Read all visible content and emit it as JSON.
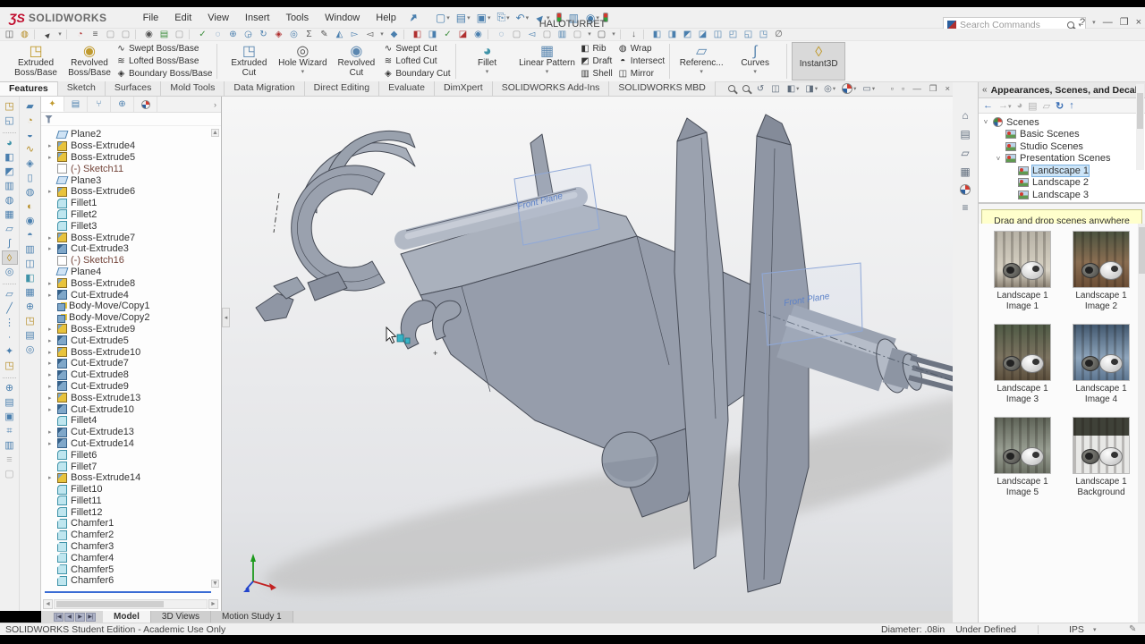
{
  "titlebar": {
    "logo_mark": "ƷS",
    "logo_text": "SOLIDWORKS",
    "menus": [
      "File",
      "Edit",
      "View",
      "Insert",
      "Tools",
      "Window",
      "Help"
    ],
    "title": "HALOTURRET",
    "search_placeholder": "Search Commands",
    "help_btn": "?",
    "win_min": "—",
    "win_restore": "❐",
    "win_close": "×"
  },
  "qat": [
    {
      "g": "▢",
      "car": "▾"
    },
    {
      "g": "▤",
      "car": "▾"
    },
    {
      "g": "▣",
      "car": "▾"
    },
    {
      "g": "⎘",
      "car": "▾"
    },
    {
      "g": "↶",
      "car": "▾"
    },
    {
      "g": "►",
      "cls": "curs",
      "car": "▾"
    },
    {
      "g": "",
      "cls": "tl"
    },
    {
      "g": "▥"
    },
    {
      "g": "◉",
      "car": "▾"
    }
  ],
  "toolbar2": [
    {
      "g": "◫",
      "cls": "dk"
    },
    {
      "g": "◍",
      "cls": "gold"
    },
    {
      "g": "",
      "cls": "sep"
    },
    {
      "g": "►",
      "cls": "curs"
    },
    {
      "g": "▾",
      "cls": "car"
    },
    {
      "g": "",
      "cls": "sep"
    },
    {
      "g": "◔",
      "cls": "red"
    },
    {
      "g": "≡",
      "cls": "dk"
    },
    {
      "g": "▢",
      "cls": "gray"
    },
    {
      "g": "▢",
      "cls": "gray"
    },
    {
      "g": "",
      "cls": "sep"
    },
    {
      "g": "◉",
      "cls": "dk"
    },
    {
      "g": "▤",
      "cls": "grn"
    },
    {
      "g": "▢",
      "cls": "gray"
    },
    {
      "g": "",
      "cls": "sep"
    },
    {
      "g": "✓",
      "cls": "grn"
    },
    {
      "g": "◌",
      "cls": ""
    },
    {
      "g": "⊕",
      "cls": ""
    },
    {
      "g": "◶",
      "cls": ""
    },
    {
      "g": "↻",
      "cls": ""
    },
    {
      "g": "◈",
      "cls": "red"
    },
    {
      "g": "◎",
      "cls": ""
    },
    {
      "g": "Σ",
      "cls": "dk"
    },
    {
      "g": "✎",
      "cls": "dk"
    },
    {
      "g": "◭",
      "cls": ""
    },
    {
      "g": "▻",
      "cls": ""
    },
    {
      "g": "◅",
      "cls": "dk"
    },
    {
      "g": "▾",
      "cls": "car"
    },
    {
      "g": "◆",
      "cls": ""
    },
    {
      "g": "",
      "cls": "sep"
    },
    {
      "g": "◧",
      "cls": "red"
    },
    {
      "g": "◨",
      "cls": ""
    },
    {
      "g": "✓",
      "cls": "grn"
    },
    {
      "g": "◪",
      "cls": "red"
    },
    {
      "g": "◉",
      "cls": ""
    },
    {
      "g": "",
      "cls": "sep"
    },
    {
      "g": "◌",
      "cls": ""
    },
    {
      "g": "▢",
      "cls": "gray"
    },
    {
      "g": "◅",
      "cls": ""
    },
    {
      "g": "▢",
      "cls": "gray"
    },
    {
      "g": "▥",
      "cls": ""
    },
    {
      "g": "▢",
      "cls": "gray"
    },
    {
      "g": "▾",
      "cls": "car"
    },
    {
      "g": "▢",
      "cls": "dk"
    },
    {
      "g": "▾",
      "cls": "car"
    },
    {
      "g": "",
      "cls": "sep"
    },
    {
      "g": "↓",
      "cls": "dk"
    },
    {
      "g": "",
      "cls": "sep"
    },
    {
      "g": "◧",
      "cls": ""
    },
    {
      "g": "◨",
      "cls": ""
    },
    {
      "g": "◩",
      "cls": ""
    },
    {
      "g": "◪",
      "cls": ""
    },
    {
      "g": "◫",
      "cls": ""
    },
    {
      "g": "◰",
      "cls": ""
    },
    {
      "g": "◱",
      "cls": ""
    },
    {
      "g": "◳",
      "cls": ""
    },
    {
      "g": "∅",
      "cls": "dk"
    }
  ],
  "ribbon": {
    "b_extruded_boss": {
      "l1": "Extruded",
      "l2": "Boss/Base",
      "g": "◳"
    },
    "b_revolved_boss": {
      "l1": "Revolved",
      "l2": "Boss/Base",
      "g": "◉"
    },
    "stack1": [
      {
        "t": "Swept Boss/Base",
        "g": "∿",
        "cls": "gold"
      },
      {
        "t": "Lofted Boss/Base",
        "g": "≋",
        "cls": "gold"
      },
      {
        "t": "Boundary Boss/Base",
        "g": "◈",
        "cls": "gold"
      }
    ],
    "b_extruded_cut": {
      "l1": "Extruded",
      "l2": "Cut",
      "g": "◳"
    },
    "b_hole_wizard": {
      "l1": "Hole Wizard",
      "g": "◎"
    },
    "b_revolved_cut": {
      "l1": "Revolved",
      "l2": "Cut",
      "g": "◉"
    },
    "stack2": [
      {
        "t": "Swept Cut",
        "g": "∿",
        "cls": "blue"
      },
      {
        "t": "Lofted Cut",
        "g": "≋",
        "cls": "blue"
      },
      {
        "t": "Boundary Cut",
        "g": "◈",
        "cls": "blue"
      }
    ],
    "b_fillet": {
      "l1": "Fillet",
      "g": "◕"
    },
    "b_linear_pattern": {
      "l1": "Linear Pattern",
      "g": "▦"
    },
    "stack3a": [
      {
        "t": "Rib",
        "g": "◧",
        "cls": "blue"
      },
      {
        "t": "Draft",
        "g": "◩",
        "cls": "blue"
      },
      {
        "t": "Shell",
        "g": "▥",
        "cls": "blue"
      }
    ],
    "stack3b": [
      {
        "t": "Wrap",
        "g": "◍",
        "cls": "blue"
      },
      {
        "t": "Intersect",
        "g": "◓",
        "cls": "blue"
      },
      {
        "t": "Mirror",
        "g": "◫",
        "cls": "blue"
      }
    ],
    "b_reference": {
      "l1": "Referenc...",
      "g": "▱"
    },
    "b_curves": {
      "l1": "Curves",
      "g": "∫"
    },
    "b_instant3d": {
      "l1": "Instant3D",
      "g": "◊"
    }
  },
  "tabs": [
    {
      "t": "Features",
      "cls": "active"
    },
    {
      "t": "Sketch"
    },
    {
      "t": "Surfaces"
    },
    {
      "t": "Mold Tools"
    },
    {
      "t": "Data Migration"
    },
    {
      "t": "Direct Editing"
    },
    {
      "t": "Evaluate"
    },
    {
      "t": "DimXpert"
    },
    {
      "t": "SOLIDWORKS Add-Ins"
    },
    {
      "t": "SOLIDWORKS MBD"
    }
  ],
  "headsup": [
    {
      "g": "",
      "cls": "magic"
    },
    {
      "g": "",
      "cls": "magic"
    },
    {
      "g": "↺"
    },
    {
      "g": "◫"
    },
    {
      "g": "◧",
      "car": "▾"
    },
    {
      "g": "◨",
      "car": "▾"
    },
    {
      "g": "◎",
      "car": "▾"
    },
    {
      "g": "",
      "cls": "ballic",
      "car": "▾"
    },
    {
      "g": "▭",
      "car": "▾"
    }
  ],
  "docwin": [
    {
      "g": "▫"
    },
    {
      "g": "▫"
    },
    {
      "g": "—"
    },
    {
      "g": "❒"
    },
    {
      "g": "×"
    }
  ],
  "left_col1": [
    {
      "g": "◳",
      "cls": "gold"
    },
    {
      "g": "◱",
      "cls": "blue"
    },
    {
      "g": "",
      "cls": "sep"
    },
    {
      "g": "◕",
      "cls": "cyan"
    },
    {
      "g": "◧",
      "cls": "blue"
    },
    {
      "g": "◩",
      "cls": "blue"
    },
    {
      "g": "▥",
      "cls": "blue"
    },
    {
      "g": "◍",
      "cls": "blue"
    },
    {
      "g": "▦",
      "cls": "blue"
    },
    {
      "g": "▱",
      "cls": "blue"
    },
    {
      "g": "∫",
      "cls": "blue"
    },
    {
      "g": "◊",
      "cls": "gold act"
    },
    {
      "g": "◎",
      "cls": "blue"
    },
    {
      "g": "",
      "cls": "sep"
    },
    {
      "g": "▱",
      "cls": "blue"
    },
    {
      "g": "╱",
      "cls": "blue"
    },
    {
      "g": "⋮",
      "cls": "blue"
    },
    {
      "g": "∙",
      "cls": "blue"
    },
    {
      "g": "✦",
      "cls": "blue"
    },
    {
      "g": "◳",
      "cls": "gold"
    },
    {
      "g": "",
      "cls": "sep"
    },
    {
      "g": "⊕",
      "cls": "blue"
    },
    {
      "g": "▤",
      "cls": "blue"
    },
    {
      "g": "▣",
      "cls": "blue"
    },
    {
      "g": "⌗",
      "cls": "blue"
    },
    {
      "g": "▥",
      "cls": "blue"
    },
    {
      "g": "≡",
      "cls": "dim"
    },
    {
      "g": "▢",
      "cls": "dim"
    }
  ],
  "left_col2": [
    {
      "g": "▰",
      "cls": "blue"
    },
    {
      "g": "◔",
      "cls": "gold"
    },
    {
      "g": "◒",
      "cls": "blue"
    },
    {
      "g": "∿",
      "cls": "gold"
    },
    {
      "g": "◈",
      "cls": "blue"
    },
    {
      "g": "▯",
      "cls": "blue"
    },
    {
      "g": "◍",
      "cls": "blue"
    },
    {
      "g": "◐",
      "cls": "gold"
    },
    {
      "g": "◉",
      "cls": "blue"
    },
    {
      "g": "◓",
      "cls": "blue"
    },
    {
      "g": "▥",
      "cls": "blue"
    },
    {
      "g": "◫",
      "cls": "blue"
    },
    {
      "g": "◧",
      "cls": "cyan"
    },
    {
      "g": "▦",
      "cls": "blue"
    },
    {
      "g": "⊕",
      "cls": "blue"
    },
    {
      "g": "◳",
      "cls": "gold"
    },
    {
      "g": "▤",
      "cls": "blue"
    },
    {
      "g": "◎",
      "cls": "blue"
    }
  ],
  "tree_tabs": [
    {
      "g": "✦",
      "cls": "active"
    },
    {
      "g": "▤"
    },
    {
      "g": "⑂"
    },
    {
      "g": "⊕"
    },
    {
      "g": ""
    }
  ],
  "tree_more": "›",
  "feature_tree": {
    "items": [
      {
        "t": "Plane2",
        "cls": "ic-plane"
      },
      {
        "t": "Boss-Extrude4",
        "cls": "ic-boss exp"
      },
      {
        "t": "Boss-Extrude5",
        "cls": "ic-boss exp"
      },
      {
        "t": "(-) Sketch11",
        "cls": "ic-sketch"
      },
      {
        "t": "Plane3",
        "cls": "ic-plane"
      },
      {
        "t": "Boss-Extrude6",
        "cls": "ic-boss exp"
      },
      {
        "t": "Fillet1",
        "cls": "ic-fillet"
      },
      {
        "t": "Fillet2",
        "cls": "ic-fillet"
      },
      {
        "t": "Fillet3",
        "cls": "ic-fillet"
      },
      {
        "t": "Boss-Extrude7",
        "cls": "ic-boss exp"
      },
      {
        "t": "Cut-Extrude3",
        "cls": "ic-cut exp"
      },
      {
        "t": "(-) Sketch16",
        "cls": "ic-sketch"
      },
      {
        "t": "Plane4",
        "cls": "ic-plane"
      },
      {
        "t": "Boss-Extrude8",
        "cls": "ic-boss exp"
      },
      {
        "t": "Cut-Extrude4",
        "cls": "ic-cut exp"
      },
      {
        "t": "Body-Move/Copy1",
        "cls": "ic-move"
      },
      {
        "t": "Body-Move/Copy2",
        "cls": "ic-move"
      },
      {
        "t": "Boss-Extrude9",
        "cls": "ic-boss exp"
      },
      {
        "t": "Cut-Extrude5",
        "cls": "ic-cut exp"
      },
      {
        "t": "Boss-Extrude10",
        "cls": "ic-boss exp"
      },
      {
        "t": "Cut-Extrude7",
        "cls": "ic-cut exp"
      },
      {
        "t": "Cut-Extrude8",
        "cls": "ic-cut exp"
      },
      {
        "t": "Cut-Extrude9",
        "cls": "ic-cut exp"
      },
      {
        "t": "Boss-Extrude13",
        "cls": "ic-boss exp"
      },
      {
        "t": "Cut-Extrude10",
        "cls": "ic-cut exp"
      },
      {
        "t": "Fillet4",
        "cls": "ic-fillet"
      },
      {
        "t": "Cut-Extrude13",
        "cls": "ic-cut exp"
      },
      {
        "t": "Cut-Extrude14",
        "cls": "ic-cut exp"
      },
      {
        "t": "Fillet6",
        "cls": "ic-fillet"
      },
      {
        "t": "Fillet7",
        "cls": "ic-fillet"
      },
      {
        "t": "Boss-Extrude14",
        "cls": "ic-boss exp"
      },
      {
        "t": "Fillet10",
        "cls": "ic-fillet"
      },
      {
        "t": "Fillet11",
        "cls": "ic-fillet"
      },
      {
        "t": "Fillet12",
        "cls": "ic-fillet"
      },
      {
        "t": "Chamfer1",
        "cls": "ic-cham"
      },
      {
        "t": "Chamfer2",
        "cls": "ic-cham"
      },
      {
        "t": "Chamfer3",
        "cls": "ic-cham"
      },
      {
        "t": "Chamfer4",
        "cls": "ic-cham"
      },
      {
        "t": "Chamfer5",
        "cls": "ic-cham"
      },
      {
        "t": "Chamfer6",
        "cls": "ic-cham"
      }
    ]
  },
  "viewport": {
    "plane1": "Front Plane",
    "plane2": "Front Plane"
  },
  "task_pane": {
    "title": "Appearances, Scenes, and Decals",
    "strip": [
      {
        "g": "⌂"
      },
      {
        "g": "▤"
      },
      {
        "g": "▱"
      },
      {
        "g": "▦"
      },
      {
        "g": "",
        "cls": "ballstrip"
      },
      {
        "g": "≡"
      }
    ],
    "toolbar": [
      {
        "g": "←",
        "cls": ""
      },
      {
        "g": "→",
        "cls": "dim",
        "car": "▾"
      },
      {
        "g": "◕",
        "cls": "dim"
      },
      {
        "g": "▤",
        "cls": "dim"
      },
      {
        "g": "▱",
        "cls": "dim"
      },
      {
        "g": "↻",
        "cls": ""
      },
      {
        "g": "↑",
        "cls": ""
      }
    ],
    "tree": [
      {
        "t": "Scenes",
        "c": "˅",
        "cls": "d0 ball-ic"
      },
      {
        "t": "Basic Scenes",
        "c": "",
        "cls": "d1"
      },
      {
        "t": "Studio Scenes",
        "c": "",
        "cls": "d1"
      },
      {
        "t": "Presentation Scenes",
        "c": "˅",
        "cls": "d1"
      },
      {
        "t": "Landscape 1",
        "c": "",
        "cls": "d2 sel"
      },
      {
        "t": "Landscape 2",
        "c": "",
        "cls": "d2"
      },
      {
        "t": "Landscape 3",
        "c": "",
        "cls": "d2"
      }
    ],
    "tooltip": "Drag and drop scenes anywhere into the graphics view.",
    "thumbs": [
      {
        "t": "Landscape 1 Image 1",
        "cls": "t1"
      },
      {
        "t": "Landscape 1 Image 2",
        "cls": "t2"
      },
      {
        "t": "Landscape 1 Image 3",
        "cls": "t3"
      },
      {
        "t": "Landscape 1 Image 4",
        "cls": "t4"
      },
      {
        "t": "Landscape 1 Image 5",
        "cls": "t5"
      },
      {
        "t": "Landscape 1 Background",
        "cls": "t6"
      }
    ]
  },
  "model_tabs": {
    "model": "Model",
    "views": "3D Views",
    "motion": "Motion Study 1"
  },
  "status": {
    "edition": "SOLIDWORKS Student Edition - Academic Use Only",
    "dim": "Diameter: .08in",
    "state": "Under Defined",
    "units": "IPS"
  }
}
